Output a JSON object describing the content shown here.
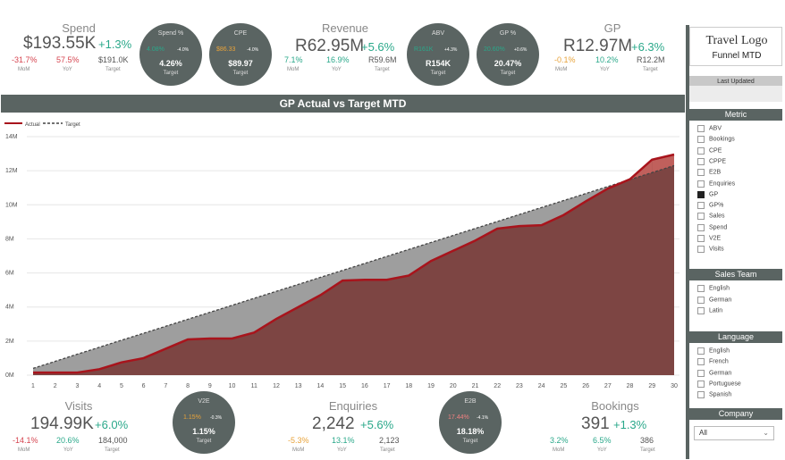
{
  "kpis_top": [
    {
      "id": "spend",
      "title": "Spend",
      "value": "$193.55K",
      "change": "+1.3%",
      "mom": "-31.7%",
      "yoy": "57.5%",
      "target": "$191.0K",
      "mom_lbl": "MoM",
      "yoy_lbl": "YoY",
      "target_lbl": "Target"
    },
    {
      "id": "revenue",
      "title": "Revenue",
      "value": "R62.95M",
      "change": "+5.6%",
      "mom": "7.1%",
      "yoy": "16.9%",
      "target": "R59.6M",
      "mom_lbl": "MoM",
      "yoy_lbl": "YoY",
      "target_lbl": "Target"
    },
    {
      "id": "gp",
      "title": "GP",
      "value": "R12.97M",
      "change": "+6.3%",
      "mom": "-0.1%",
      "yoy": "10.2%",
      "target": "R12.2M",
      "mom_lbl": "MoM",
      "yoy_lbl": "YoY",
      "target_lbl": "Target"
    }
  ],
  "kpis_bottom": [
    {
      "id": "visits",
      "title": "Visits",
      "value": "194.99K",
      "change": "+6.0%",
      "mom": "-14.1%",
      "yoy": "20.6%",
      "target": "184,000",
      "mom_lbl": "MoM",
      "yoy_lbl": "YoY",
      "target_lbl": "Target"
    },
    {
      "id": "enquiries",
      "title": "Enquiries",
      "value": "2,242",
      "change": "+5.6%",
      "mom": "-5.3%",
      "yoy": "13.1%",
      "target": "2,123",
      "mom_lbl": "MoM",
      "yoy_lbl": "YoY",
      "target_lbl": "Target"
    },
    {
      "id": "bookings",
      "title": "Bookings",
      "value": "391",
      "change": "+1.3%",
      "mom": "3.2%",
      "yoy": "6.5%",
      "target": "386",
      "mom_lbl": "MoM",
      "yoy_lbl": "YoY",
      "target_lbl": "Target"
    }
  ],
  "circles": [
    {
      "id": "spend_pct",
      "title": "Spend %",
      "left": "4.08%",
      "delta": "-4.0%",
      "main": "4.26%",
      "lbl": "Target"
    },
    {
      "id": "cpe",
      "title": "CPE",
      "left": "$86.33",
      "delta": "-4.0%",
      "main": "$89.97",
      "lbl": "Target"
    },
    {
      "id": "abv",
      "title": "ABV",
      "left": "R161K",
      "delta": "+4.3%",
      "main": "R154K",
      "lbl": "Target"
    },
    {
      "id": "gp_pct",
      "title": "GP %",
      "left": "20.60%",
      "delta": "+0.6%",
      "main": "20.47%",
      "lbl": "Target"
    },
    {
      "id": "v2e",
      "title": "V2E",
      "left": "1.15%",
      "delta": "-0.3%",
      "main": "1.15%",
      "lbl": "Target"
    },
    {
      "id": "e2b",
      "title": "E2B",
      "left": "17.44%",
      "delta": "-4.1%",
      "main": "18.18%",
      "lbl": "Target"
    }
  ],
  "sidebar": {
    "logo": "Travel Logo",
    "subtitle": "Funnel MTD",
    "last_updated_label": "Last Updated",
    "metric_label": "Metric",
    "metrics": [
      "ABV",
      "Bookings",
      "CPE",
      "CPPE",
      "E2B",
      "Enquiries",
      "GP",
      "GP%",
      "Sales",
      "Spend",
      "V2E",
      "Visits"
    ],
    "metric_selected": "GP",
    "sales_team_label": "Sales Team",
    "sales_teams": [
      "English",
      "German",
      "Latin"
    ],
    "language_label": "Language",
    "languages": [
      "English",
      "French",
      "German",
      "Portuguese",
      "Spanish"
    ],
    "company_label": "Company",
    "company_value": "All"
  },
  "chart_data": {
    "type": "area",
    "title": "GP Actual vs Target MTD",
    "x": [
      1,
      2,
      3,
      4,
      5,
      6,
      7,
      8,
      9,
      10,
      11,
      12,
      13,
      14,
      15,
      16,
      17,
      18,
      19,
      20,
      21,
      22,
      23,
      24,
      25,
      26,
      27,
      28,
      29,
      30
    ],
    "series": [
      {
        "name": "Actual",
        "color": "#a8141c",
        "values": [
          0.15,
          0.15,
          0.15,
          0.35,
          0.75,
          1.0,
          1.55,
          2.1,
          2.15,
          2.15,
          2.5,
          3.3,
          4.0,
          4.7,
          5.55,
          5.6,
          5.6,
          5.85,
          6.7,
          7.3,
          7.9,
          8.6,
          8.75,
          8.8,
          9.4,
          10.2,
          10.95,
          11.5,
          12.65,
          12.95
        ]
      },
      {
        "name": "Target",
        "color": "#444444",
        "values": [
          0.4,
          0.81,
          1.23,
          1.64,
          2.05,
          2.46,
          2.87,
          3.28,
          3.69,
          4.1,
          4.51,
          4.92,
          5.33,
          5.74,
          6.15,
          6.56,
          6.97,
          7.38,
          7.79,
          8.2,
          8.61,
          9.02,
          9.43,
          9.84,
          10.25,
          10.66,
          11.07,
          11.48,
          11.89,
          12.3
        ]
      }
    ],
    "y_ticks": [
      "0M",
      "2M",
      "4M",
      "6M",
      "8M",
      "10M",
      "12M",
      "14M"
    ],
    "ylim": [
      0,
      14
    ],
    "legend": "top-left",
    "colors": {
      "actual_fill": "#7d4543",
      "over_fill": "#c0605c",
      "target_fill": "#9e9e9e"
    }
  }
}
